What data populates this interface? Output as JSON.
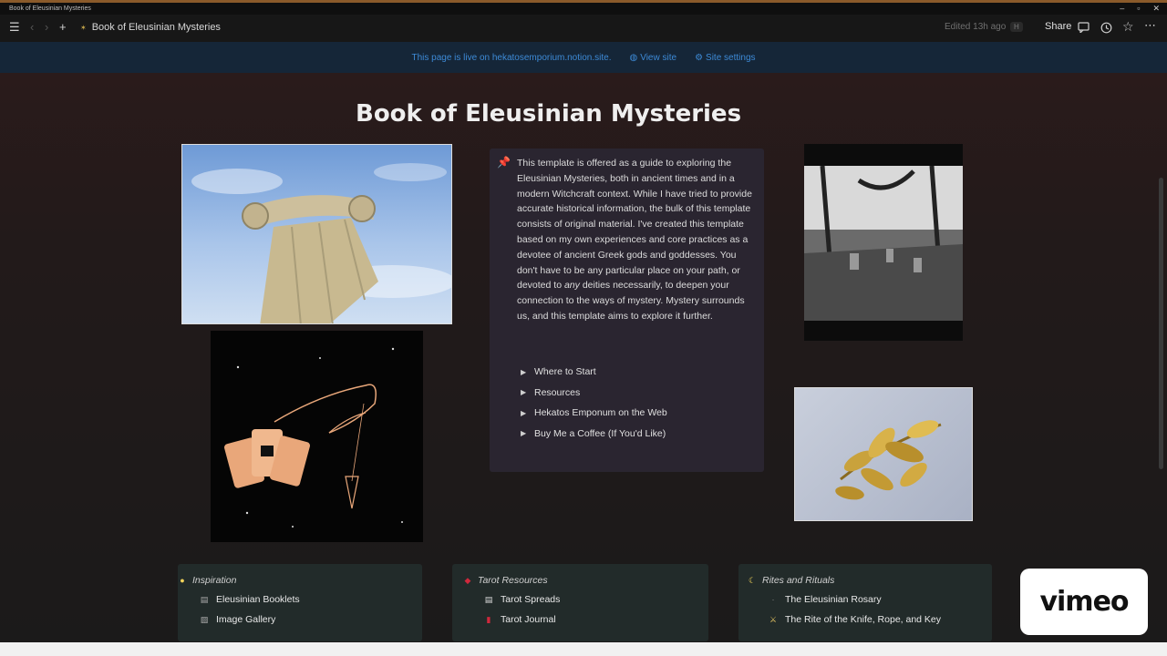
{
  "window": {
    "os_title": "Book of Eleusinian Mysteries"
  },
  "topbar": {
    "page_title": "Book of Eleusinian Mysteries",
    "edited": "Edited 13h ago",
    "badge": "H",
    "share_label": "Share"
  },
  "banner": {
    "live_text": "This page is live on hekatosemporium.notion.site.",
    "view_site": "View site",
    "site_settings": "Site settings"
  },
  "page": {
    "title": "Book of Eleusinian Mysteries",
    "callout": {
      "icon": "pushpin-icon",
      "body_before": "This template is offered as a guide to exploring the Eleusinian Mysteries, both in ancient times and in a modern Witchcraft context. While I have tried to provide accurate historical information, the bulk of this template consists of original material. I've created this template based on my own experiences and core practices as a devotee of ancient Greek gods and goddesses. You don't have to be any particular place on your path, or devoted to ",
      "body_em": "any",
      "body_after": " deities necessarily, to deepen your connection to the ways of mystery. Mystery surrounds us, and this template aims to explore it further.",
      "toggles": [
        "Where to Start",
        "Resources",
        "Hekatos Emponum on the Web",
        "Buy Me a Coffee (If You'd Like)"
      ]
    },
    "link_cards": [
      {
        "heading": "Inspiration",
        "icon": "lightbulb-icon",
        "items": [
          "Eleusinian Booklets",
          "Image Gallery"
        ]
      },
      {
        "heading": "Tarot Resources",
        "icon": "red-gem-icon",
        "items": [
          "Tarot Spreads",
          "Tarot Journal"
        ]
      },
      {
        "heading": "Rites and Rituals",
        "icon": "crescent-moon-icon",
        "items": [
          "The Eleusinian Rosary",
          "The Rite of the Knife, Rope, and Key"
        ]
      }
    ]
  },
  "overlay": {
    "vimeo": "vimeo"
  },
  "colors": {
    "accent_link": "#3d8ad6",
    "callout_bg": "#2a2530",
    "card_bg": "#222b2a"
  }
}
